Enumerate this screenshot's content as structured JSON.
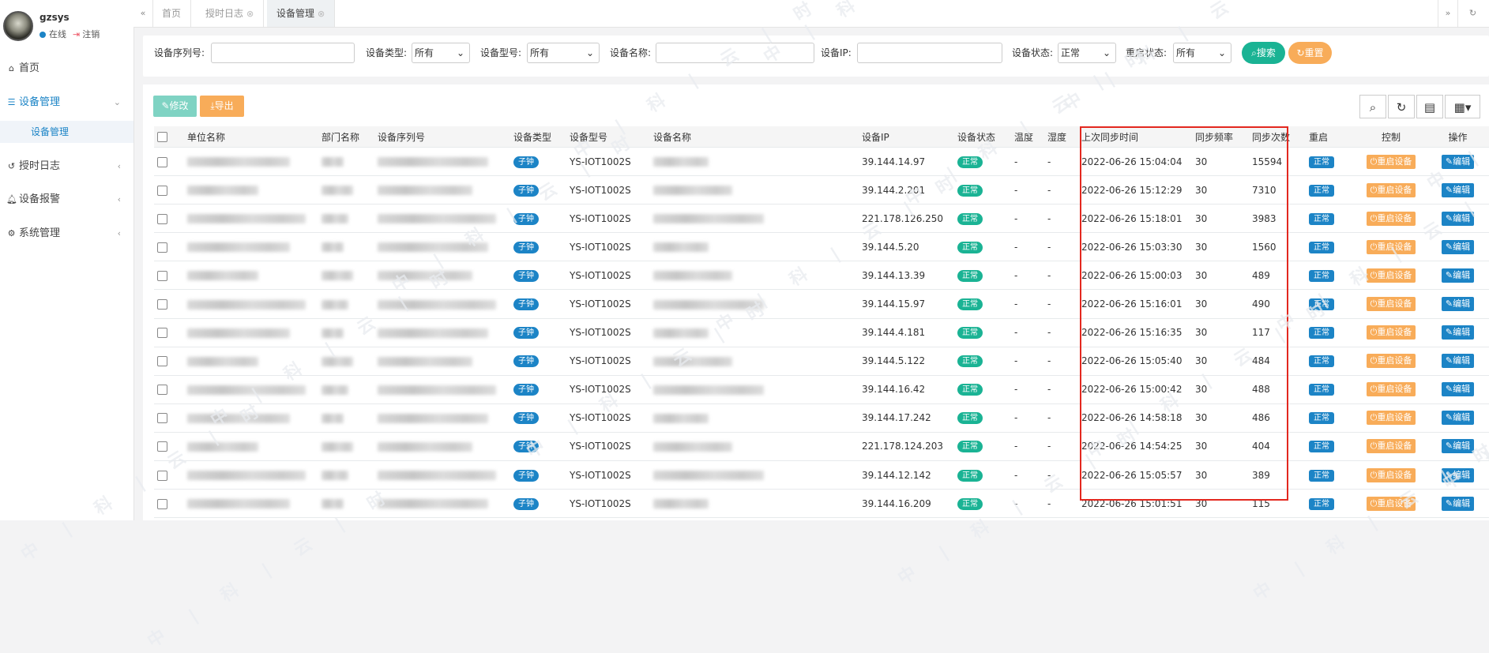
{
  "user": {
    "name": "gzsys",
    "status": "在线",
    "logout": "注销"
  },
  "nav": {
    "home": "首页",
    "device_mgmt": "设备管理",
    "device_mgmt_sub": "设备管理",
    "sync_log": "授时日志",
    "device_alarm": "设备报警",
    "system_mgmt": "系统管理"
  },
  "tabs": [
    {
      "label": "首页"
    },
    {
      "label": "授时日志"
    },
    {
      "label": "设备管理"
    }
  ],
  "filters": {
    "serial_label": "设备序列号:",
    "type_label": "设备类型:",
    "type_value": "所有",
    "model_label": "设备型号:",
    "model_value": "所有",
    "name_label": "设备名称:",
    "ip_label": "设备IP:",
    "status_label": "设备状态:",
    "status_value": "正常",
    "restart_label": "重启状态:",
    "restart_value": "所有",
    "search_btn": "搜索",
    "reset_btn": "重置"
  },
  "toolbar": {
    "edit_btn": "修改",
    "export_btn": "导出"
  },
  "table": {
    "headers": [
      "单位名称",
      "部门名称",
      "设备序列号",
      "设备类型",
      "设备型号",
      "设备名称",
      "设备IP",
      "设备状态",
      "温度",
      "湿度",
      "上次同步时间",
      "同步频率",
      "同步次数",
      "重启",
      "控制",
      "操作"
    ],
    "type_badge": "子钟",
    "status_badge": "正常",
    "restart_badge": "正常",
    "restart_btn": "重启设备",
    "edit_btn": "编辑",
    "rows": [
      {
        "model": "YS-IOT1002S",
        "ip": "39.144.14.97",
        "temp": "-",
        "hum": "-",
        "sync_time": "2022-06-26 15:04:04",
        "freq": "30",
        "count": "15594"
      },
      {
        "model": "YS-IOT1002S",
        "ip": "39.144.2.201",
        "temp": "-",
        "hum": "-",
        "sync_time": "2022-06-26 15:12:29",
        "freq": "30",
        "count": "7310"
      },
      {
        "model": "YS-IOT1002S",
        "ip": "221.178.126.250",
        "temp": "-",
        "hum": "-",
        "sync_time": "2022-06-26 15:18:01",
        "freq": "30",
        "count": "3983"
      },
      {
        "model": "YS-IOT1002S",
        "ip": "39.144.5.20",
        "temp": "-",
        "hum": "-",
        "sync_time": "2022-06-26 15:03:30",
        "freq": "30",
        "count": "1560"
      },
      {
        "model": "YS-IOT1002S",
        "ip": "39.144.13.39",
        "temp": "-",
        "hum": "-",
        "sync_time": "2022-06-26 15:00:03",
        "freq": "30",
        "count": "489"
      },
      {
        "model": "YS-IOT1002S",
        "ip": "39.144.15.97",
        "temp": "-",
        "hum": "-",
        "sync_time": "2022-06-26 15:16:01",
        "freq": "30",
        "count": "490"
      },
      {
        "model": "YS-IOT1002S",
        "ip": "39.144.4.181",
        "temp": "-",
        "hum": "-",
        "sync_time": "2022-06-26 15:16:35",
        "freq": "30",
        "count": "117"
      },
      {
        "model": "YS-IOT1002S",
        "ip": "39.144.5.122",
        "temp": "-",
        "hum": "-",
        "sync_time": "2022-06-26 15:05:40",
        "freq": "30",
        "count": "484"
      },
      {
        "model": "YS-IOT1002S",
        "ip": "39.144.16.42",
        "temp": "-",
        "hum": "-",
        "sync_time": "2022-06-26 15:00:42",
        "freq": "30",
        "count": "488"
      },
      {
        "model": "YS-IOT1002S",
        "ip": "39.144.17.242",
        "temp": "-",
        "hum": "-",
        "sync_time": "2022-06-26 14:58:18",
        "freq": "30",
        "count": "486"
      },
      {
        "model": "YS-IOT1002S",
        "ip": "221.178.124.203",
        "temp": "-",
        "hum": "-",
        "sync_time": "2022-06-26 14:54:25",
        "freq": "30",
        "count": "404"
      },
      {
        "model": "YS-IOT1002S",
        "ip": "39.144.12.142",
        "temp": "-",
        "hum": "-",
        "sync_time": "2022-06-26 15:05:57",
        "freq": "30",
        "count": "389"
      },
      {
        "model": "YS-IOT1002S",
        "ip": "39.144.16.209",
        "temp": "-",
        "hum": "-",
        "sync_time": "2022-06-26 15:01:51",
        "freq": "30",
        "count": "115"
      }
    ]
  },
  "watermark": "中 | 科 | 云 | 时",
  "colors": {
    "primary": "#1c84c6",
    "success": "#1ab394",
    "warning": "#f8ac59",
    "highlight": "#e3281f",
    "edit_btn_bg": "#7fd3c3"
  }
}
